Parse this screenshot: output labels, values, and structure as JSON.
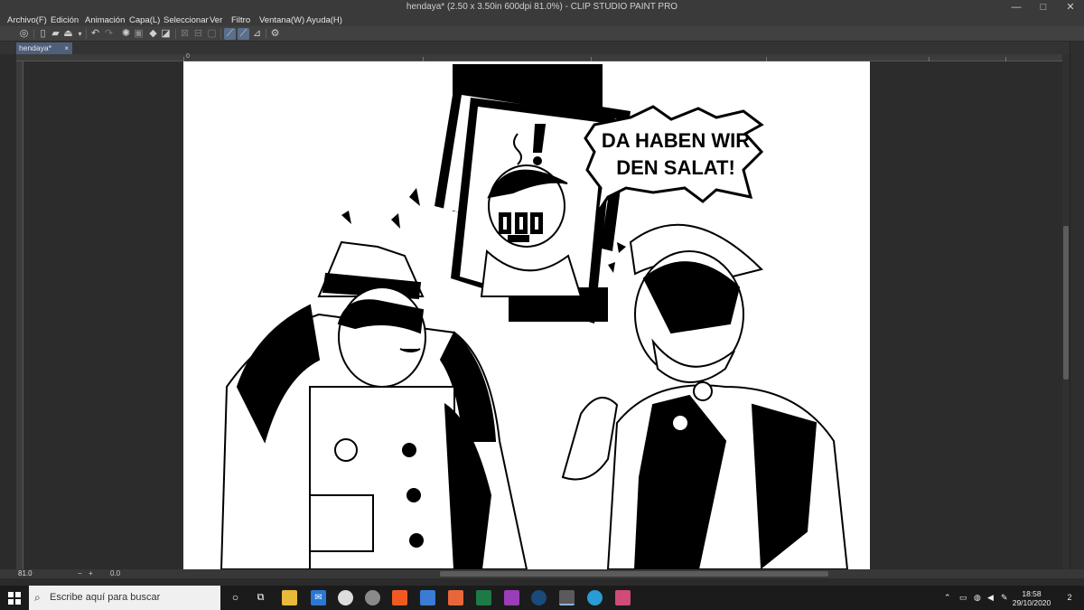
{
  "window": {
    "title": "hendaya* (2.50 x 3.50in 600dpi 81.0%) - CLIP STUDIO PAINT PRO",
    "minimize": "—",
    "maximize": "□",
    "close": "✕"
  },
  "menu": [
    "Archivo(F)",
    "Edición",
    "Animación",
    "Capa(L)",
    "Seleccionar",
    "Ver",
    "Filtro",
    "Ventana(W)",
    "Ayuda(H)"
  ],
  "toolbar": {
    "icons": [
      "app-logo-icon",
      "new-file-icon",
      "open-folder-icon",
      "save-icon",
      "dropdown-icon",
      "undo-icon",
      "redo-icon",
      "loading-icon",
      "clear-icon",
      "fill-icon",
      "transform-icon",
      "deselect-icon",
      "invert-icon",
      "border-icon",
      "snap-ruler-icon",
      "snap-special-ruler-icon",
      "snap-grid-icon",
      "settings-icon"
    ]
  },
  "document_tab": {
    "label": "hendaya*",
    "close": "×"
  },
  "ruler": {
    "origin": "0"
  },
  "artwork": {
    "speech_line1": "DA HABEN WIR",
    "speech_line2": "DEN SALAT!"
  },
  "statusbar": {
    "zoom": "81.0",
    "rotation": "0.0",
    "controls": [
      "−",
      "+"
    ]
  },
  "taskbar": {
    "search_placeholder": "Escribe aquí para buscar",
    "time": "18:58",
    "date": "29/10/2020",
    "notifications": "2",
    "apps": [
      {
        "name": "task-view",
        "color": "#1b1b1b"
      },
      {
        "name": "file-explorer",
        "color": "#e8b93a"
      },
      {
        "name": "mail",
        "color": "#2a77d4"
      },
      {
        "name": "chrome",
        "color": "#dddddd"
      },
      {
        "name": "app-swirl",
        "color": "#8a8a8a"
      },
      {
        "name": "brave",
        "color": "#f05a22"
      },
      {
        "name": "onedrive",
        "color": "#3a7bd5"
      },
      {
        "name": "office-doc",
        "color": "#e8663a"
      },
      {
        "name": "excel",
        "color": "#1d7a45"
      },
      {
        "name": "app-purple",
        "color": "#9b3db8"
      },
      {
        "name": "steam",
        "color": "#1a4a7a"
      },
      {
        "name": "clip-studio",
        "color": "#5a5a5a"
      },
      {
        "name": "telegram",
        "color": "#2a9bd4"
      },
      {
        "name": "app-pink",
        "color": "#d04b7a"
      }
    ]
  }
}
